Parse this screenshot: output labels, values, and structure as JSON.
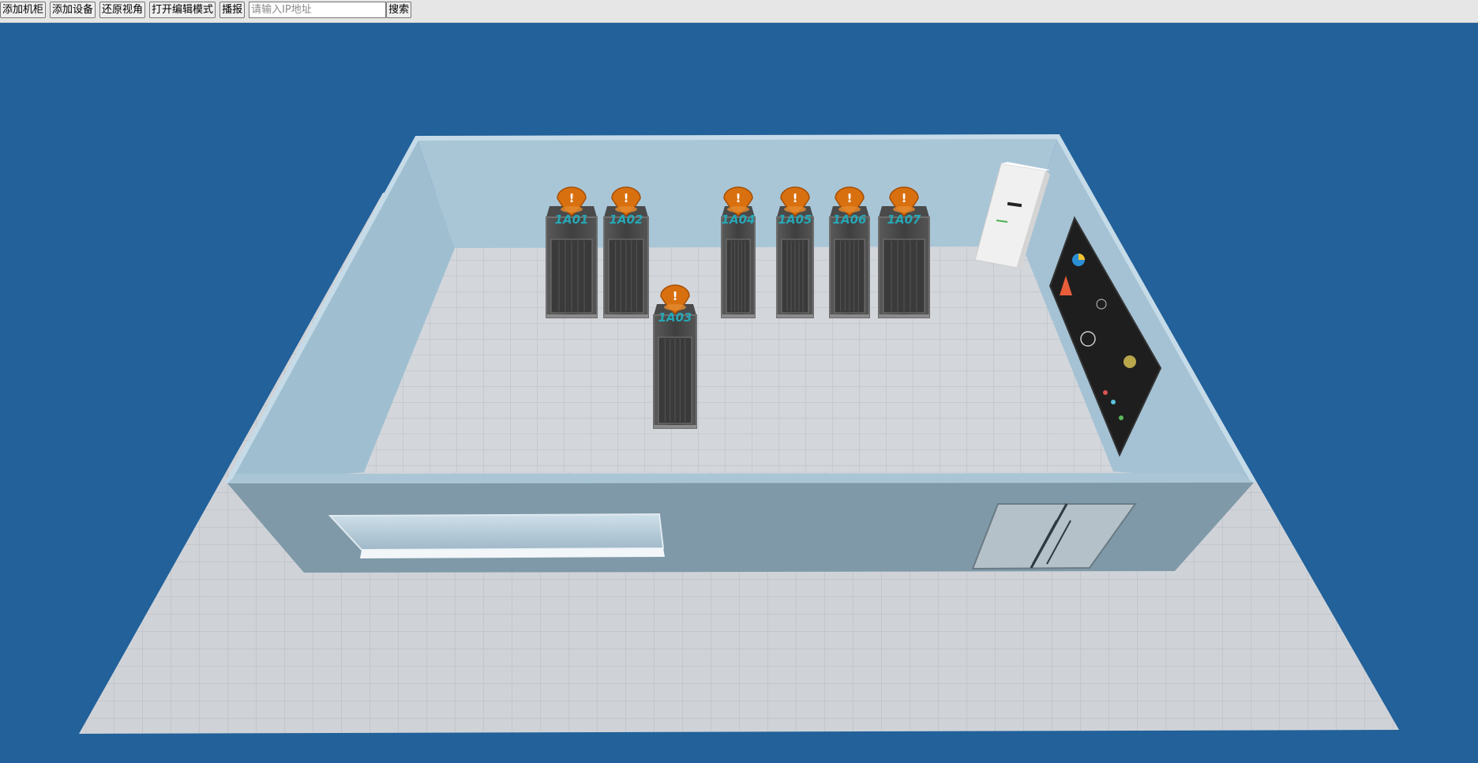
{
  "toolbar": {
    "add_cabinet": "添加机柜",
    "add_device": "添加设备",
    "reset_view": "还原视角",
    "edit_mode": "打开编辑模式",
    "report": "播报",
    "ip_placeholder": "请输入IP地址",
    "search": "搜索"
  },
  "scene": {
    "background_color": "#22619a",
    "alarm_symbol": "!",
    "racks": [
      {
        "label": "1A01"
      },
      {
        "label": "1A02"
      },
      {
        "label": "1A03"
      },
      {
        "label": "1A04"
      },
      {
        "label": "1A05"
      },
      {
        "label": "1A06"
      },
      {
        "label": "1A07"
      }
    ]
  }
}
